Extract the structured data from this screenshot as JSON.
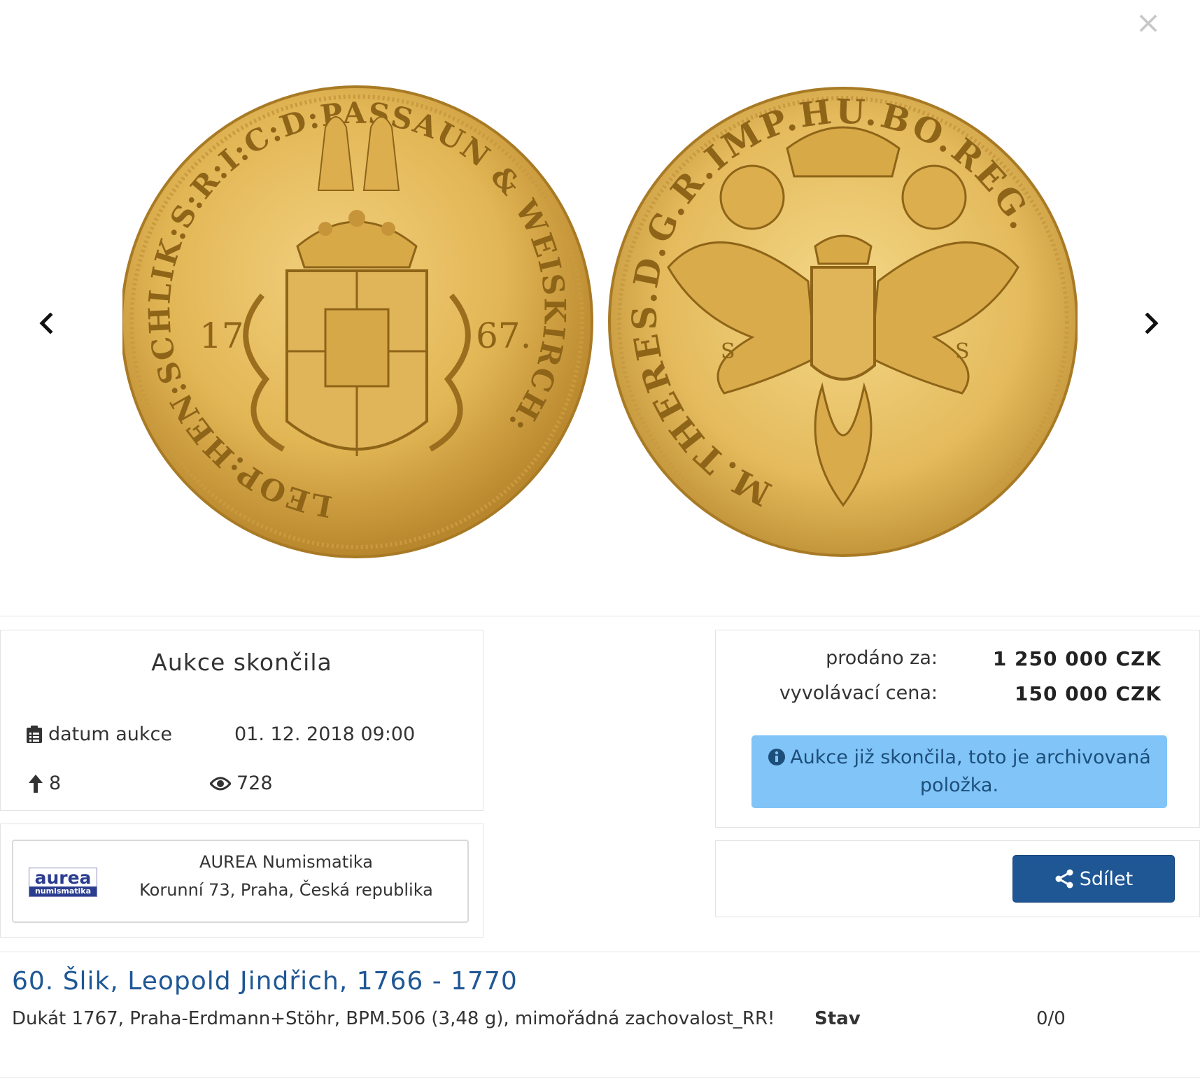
{
  "gallery": {
    "prev_icon": "chevron-left-icon",
    "next_icon": "chevron-right-icon",
    "close_label": "×",
    "coin_obverse_legend": "LEOP:HEN:SCHLIK:S:R:I:C:D:PASSAUN & WEISKIRCH:",
    "coin_obverse_year_left": "17",
    "coin_obverse_year_right": "67.",
    "coin_reverse_legend": "M.THERES.D.G.R.IMP.HU.BO.REG."
  },
  "status": {
    "title": "Aukce skončila",
    "date_label": "datum aukce",
    "date_value": "01. 12. 2018 09:00",
    "bids_count": "8",
    "views_count": "728"
  },
  "seller": {
    "logo_text": "aurea",
    "logo_subtext": "numismatika",
    "name": "AUREA Numismatika",
    "address": "Korunní 73, Praha, Česká republika"
  },
  "price": {
    "sold_label": "prodáno za:",
    "sold_value": "1 250 000 CZK",
    "start_label": "vyvolávací cena:",
    "start_value": "150 000 CZK",
    "alert_text": "Aukce již skončila, toto je archivovaná položka."
  },
  "share": {
    "label": "Sdílet"
  },
  "lot": {
    "title": "60. Šlik, Leopold Jindřich, 1766 - 1770",
    "description": "Dukát 1767, Praha-Erdmann+Stöhr, BPM.506 (3,48 g), mimořádná zachovalost_RR!",
    "state_label": "Stav",
    "state_value": "0/0"
  },
  "colors": {
    "link_blue": "#1f5795",
    "alert_bg": "#80c4f8",
    "button_bg": "#1f5795",
    "gold": "#e3b85a"
  }
}
